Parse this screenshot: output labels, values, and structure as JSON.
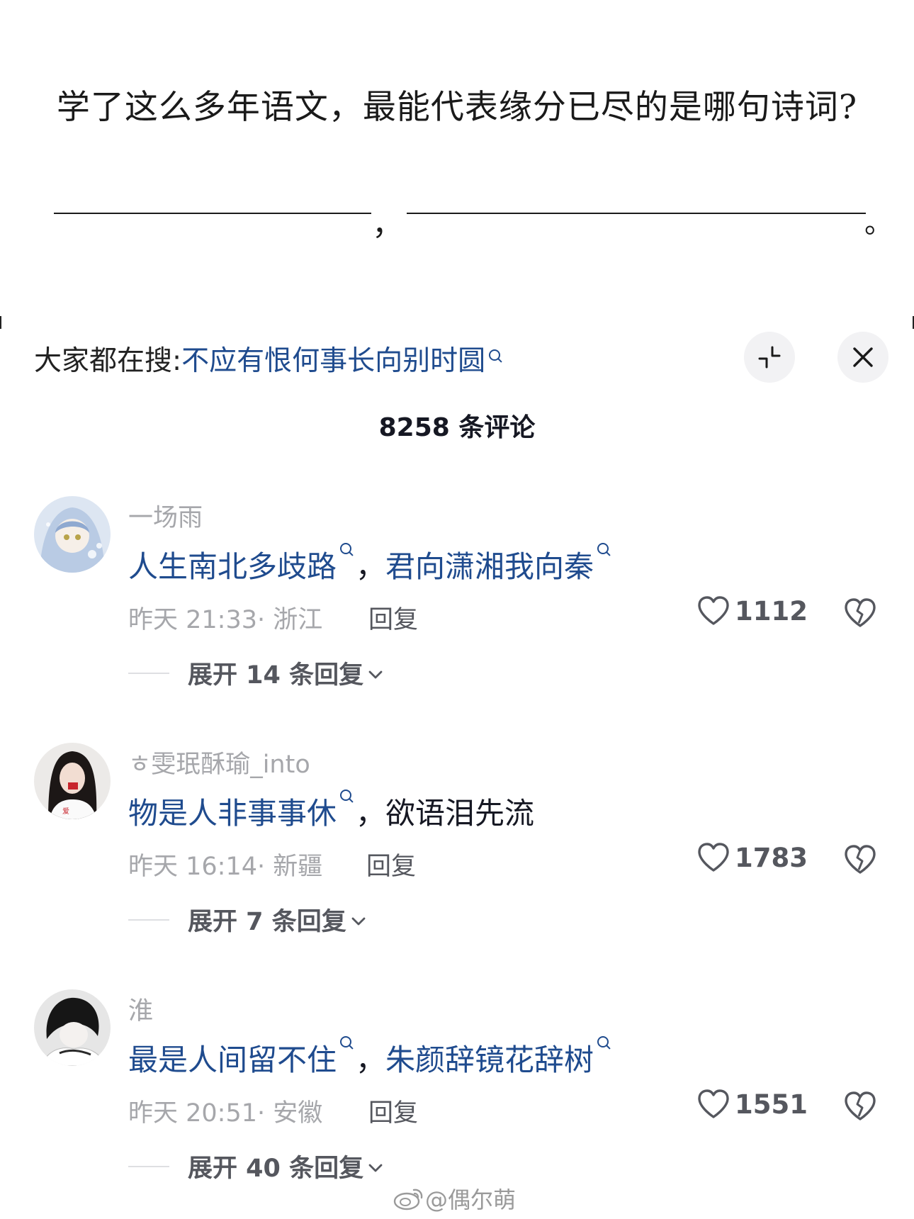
{
  "question": {
    "text": "学了这么多年语文，最能代表缘分已尽的是哪句诗词?",
    "comma": "，",
    "period": "。"
  },
  "search": {
    "prefix": "大家都在搜:",
    "term": "不应有恨何事长向别时圆"
  },
  "header": {
    "count_label": "8258 条评论"
  },
  "comments": [
    {
      "username": "一场雨",
      "line_a": "人生南北多歧路",
      "sep": "，",
      "line_b": "君向潇湘我向秦",
      "meta": "昨天 21:33· 浙江",
      "reply": "回复",
      "likes": "1112",
      "expand": "展开 14 条回复"
    },
    {
      "username": "ㅎ雯珉酥瑜_into",
      "line_a": "物是人非事事休",
      "sep": "，",
      "line_b": "欲语泪先流",
      "meta": "昨天 16:14· 新疆",
      "reply": "回复",
      "likes": "1783",
      "expand": "展开 7 条回复"
    },
    {
      "username": "淮",
      "line_a": "最是人间留不住",
      "sep": "，",
      "line_b": "朱颜辞镜花辞树",
      "meta": "昨天 20:51· 安徽",
      "reply": "回复",
      "likes": "1551",
      "expand": "展开 40 条回复"
    }
  ],
  "watermark": "@偶尔萌",
  "icons": {
    "search": "search-icon",
    "collapse": "collapse-icon",
    "close": "close-icon",
    "like": "heart-icon",
    "dislike": "broken-heart-icon",
    "expand": "chevron-down-icon",
    "weibo": "weibo-logo-icon"
  },
  "colors": {
    "link_blue": "#1f4b8e",
    "muted_gray": "#a6a7ab",
    "text_dark": "#161823"
  }
}
